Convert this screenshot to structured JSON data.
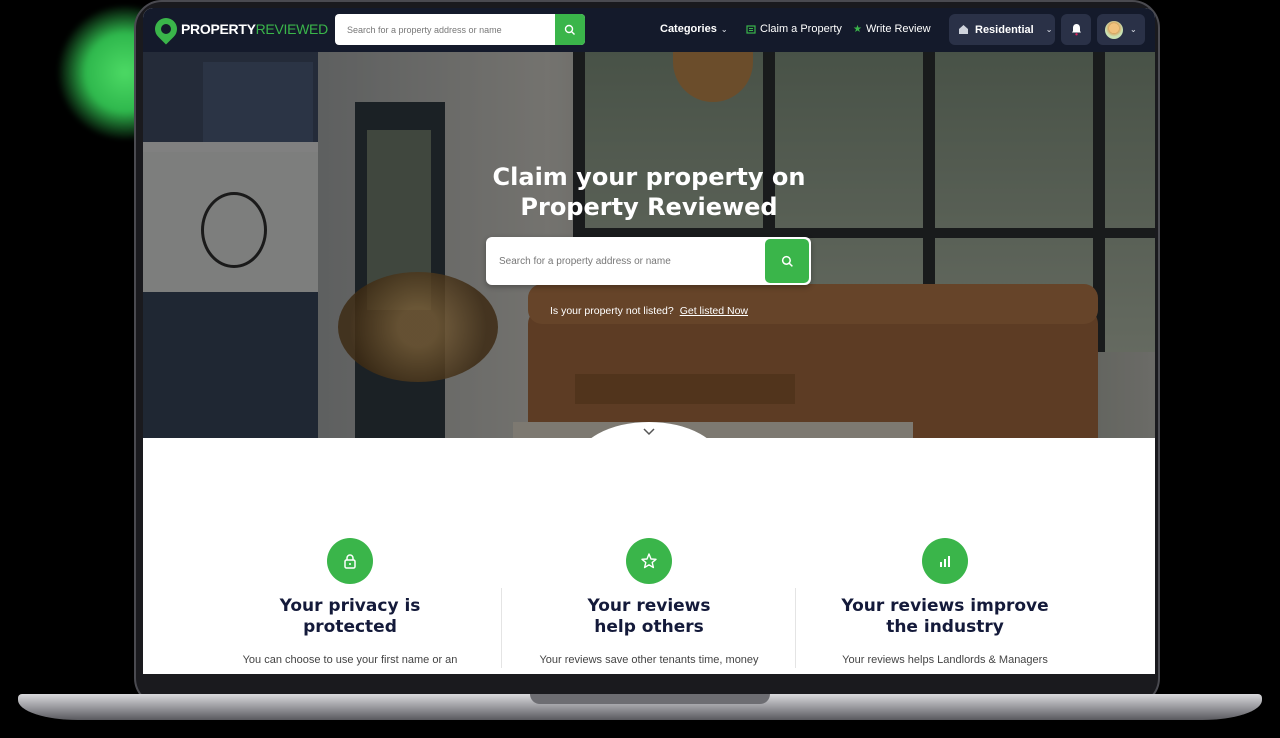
{
  "nav": {
    "logo_main": "PROPERTY",
    "logo_accent": "REVIEWED",
    "search_placeholder": "Search for a property address or name",
    "categories_label": "Categories",
    "claim_label": "Claim a Property",
    "write_review_label": "Write Review",
    "property_type_label": "Residential"
  },
  "hero": {
    "title_line1": "Claim your property on",
    "title_line2": "Property Reviewed",
    "search_placeholder": "Search for a property address or name",
    "not_listed_text": "Is your property not listed?",
    "get_listed_link": "Get listed Now"
  },
  "features": [
    {
      "icon": "lock-icon",
      "title_line1": "Your privacy is",
      "title_line2": "protected",
      "body": "You can choose to use your first name or an"
    },
    {
      "icon": "star-icon",
      "title_line1": "Your reviews",
      "title_line2": "help others",
      "body": "Your reviews save other tenants time, money"
    },
    {
      "icon": "bar-chart-icon",
      "title_line1": "Your reviews improve",
      "title_line2": "the industry",
      "body": "Your reviews helps Landlords & Managers"
    }
  ],
  "colors": {
    "brand_green": "#3ab54a",
    "nav_bg": "#141a2b",
    "heading": "#141a3a"
  }
}
